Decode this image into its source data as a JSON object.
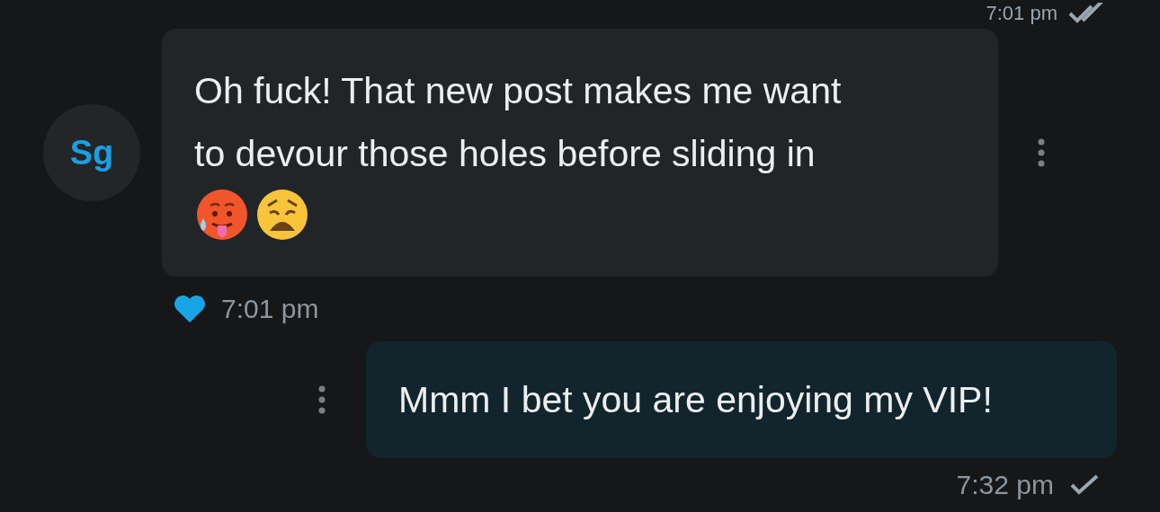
{
  "top_status": {
    "time": "7:01 pm",
    "read": true
  },
  "messages": [
    {
      "kind": "incoming",
      "avatar": "Sg",
      "lines": [
        "Oh fuck! That new post makes me want",
        "to devour those holes before sliding in"
      ],
      "emojis": [
        {
          "kind": "hot"
        },
        {
          "kind": "weary"
        }
      ],
      "liked": true,
      "time": "7:01 pm"
    },
    {
      "kind": "outgoing",
      "lines": [
        "Mmm I bet you are enjoying my VIP!"
      ],
      "time": "7:32 pm",
      "read": false
    }
  ]
}
